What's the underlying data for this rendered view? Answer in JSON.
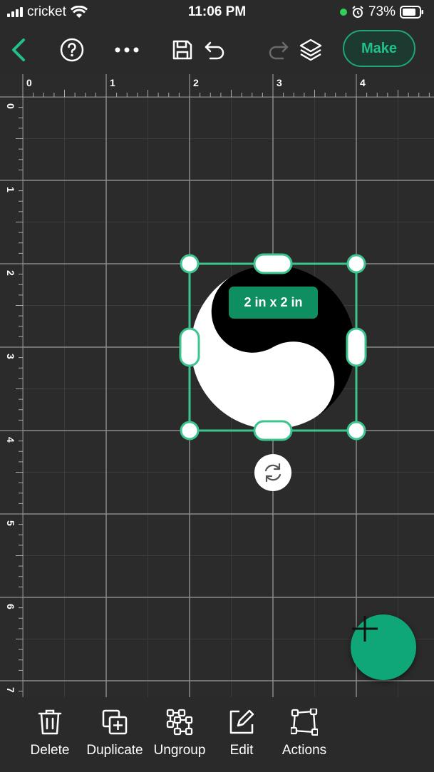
{
  "status": {
    "carrier": "cricket",
    "time": "11:06 PM",
    "battery": "73%"
  },
  "toolbar": {
    "make_label": "Make",
    "icons": [
      "back-icon",
      "help-icon",
      "more-icon",
      "save-icon",
      "undo-icon",
      "redo-icon",
      "layers-icon"
    ]
  },
  "canvas": {
    "ruler_top": [
      "0",
      "1",
      "2",
      "3",
      "4"
    ],
    "ruler_left": [
      "0",
      "1",
      "2",
      "3",
      "4",
      "5",
      "6",
      "7"
    ],
    "selection_size": "2 in x 2 in",
    "object": "yin-yang"
  },
  "bottom": {
    "delete": "Delete",
    "duplicate": "Duplicate",
    "ungroup": "Ungroup",
    "edit": "Edit",
    "actions": "Actions"
  },
  "colors": {
    "accent": "#10a778",
    "selection": "#3cc48f",
    "background": "#2b2b2b"
  }
}
